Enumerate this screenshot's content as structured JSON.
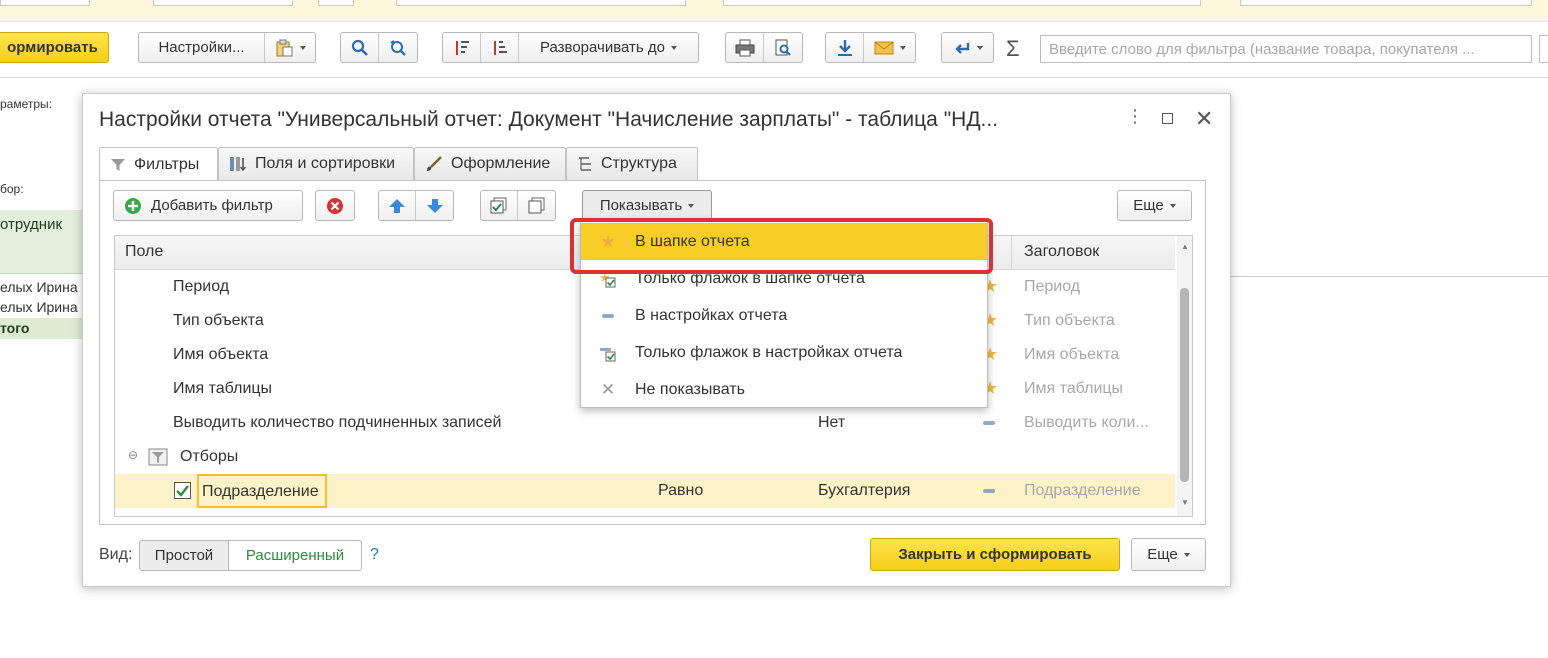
{
  "toolbar": {
    "form_label": "ормировать",
    "settings_label": "Настройки...",
    "expand_label": "Разворачивать до",
    "search_placeholder": "Введите слово для фильтра (название товара, покупателя ..."
  },
  "background": {
    "params_label": "раметры:",
    "filter_label": "бор:",
    "col_employee": "отрудник",
    "row1": "елых Ирина Е",
    "row2": "елых Ирина Е",
    "total": "того"
  },
  "dialog": {
    "title": "Настройки отчета \"Универсальный отчет: Документ \"Начисление зарплаты\" - таблица \"НД...",
    "tabs": [
      {
        "label": "Фильтры",
        "active": true
      },
      {
        "label": "Поля и сортировки",
        "active": false
      },
      {
        "label": "Оформление",
        "active": false
      },
      {
        "label": "Структура",
        "active": false
      }
    ],
    "add_filter_label": "Добавить фильтр",
    "show_label": "Показывать",
    "more_label": "Еще",
    "grid": {
      "col_field": "Поле",
      "col_header": "Заголовок",
      "rows": [
        {
          "field": "Период",
          "condition": "",
          "value": "",
          "header": "Период",
          "marker": "star"
        },
        {
          "field": "Тип объекта",
          "condition": "",
          "value": "",
          "header": "Тип объекта",
          "marker": "star"
        },
        {
          "field": "Имя объекта",
          "condition": "",
          "value": "",
          "header": "Имя объекта",
          "marker": "star"
        },
        {
          "field": "Имя таблицы",
          "condition": "",
          "value": "",
          "header": "Имя таблицы",
          "marker": "star"
        },
        {
          "field": "Выводить количество подчиненных записей",
          "condition": "",
          "value": "Нет",
          "header": "Выводить коли...",
          "marker": "dash"
        }
      ],
      "group_label": "Отборы",
      "selected_row": {
        "field": "Подразделение",
        "condition": "Равно",
        "value": "Бухгалтерия",
        "header": "Подразделение"
      }
    },
    "dropdown": [
      {
        "label": "В шапке отчета",
        "icon": "star-icon",
        "selected": true
      },
      {
        "label": "Только флажок в шапке отчета",
        "icon": "star-check-icon",
        "selected": false
      },
      {
        "label": "В настройках отчета",
        "icon": "dash-icon",
        "selected": false
      },
      {
        "label": "Только флажок в настройках отчета",
        "icon": "dash-check-icon",
        "selected": false
      },
      {
        "label": "Не показывать",
        "icon": "cross-icon",
        "selected": false
      }
    ],
    "footer": {
      "view_label": "Вид:",
      "simple_label": "Простой",
      "extended_label": "Расширенный",
      "help_label": "?",
      "close_build_label": "Закрыть и сформировать",
      "more_label": "Еще"
    }
  },
  "colors": {
    "accent_yellow": "#f5cf17",
    "selected_row": "#fdf3c8",
    "highlight_red": "#d83232",
    "star": "#f3b735",
    "extended_green": "#2e8b3e"
  }
}
